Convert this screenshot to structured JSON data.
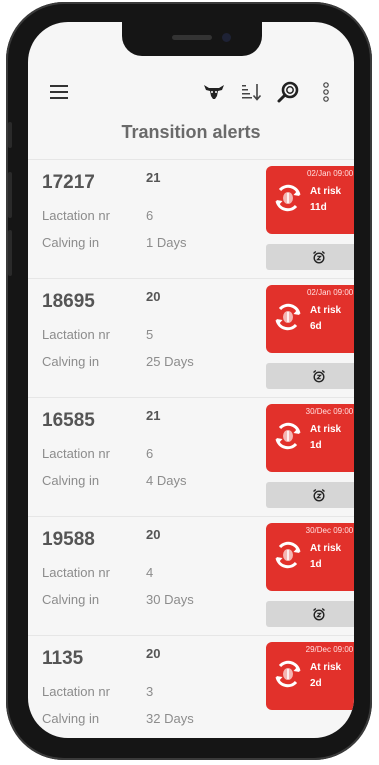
{
  "page": {
    "title": "Transition alerts"
  },
  "toolbar": {
    "icons": [
      "menu-icon",
      "cow-icon",
      "sort-icon",
      "search-icon",
      "more-icon"
    ]
  },
  "fields": {
    "lactation_label": "Lactation nr",
    "calving_label": "Calving in"
  },
  "colors": {
    "alert_red": "#e2312b",
    "alarm_button": "#d6d6d6"
  },
  "cows": [
    {
      "id": "17217",
      "number": "21",
      "lactation": "6",
      "calving": "1 Days",
      "alert_time": "02/Jan 09:00 AM",
      "status": "At risk",
      "days": "11d"
    },
    {
      "id": "18695",
      "number": "20",
      "lactation": "5",
      "calving": "25 Days",
      "alert_time": "02/Jan 09:00 AM",
      "status": "At risk",
      "days": "6d"
    },
    {
      "id": "16585",
      "number": "21",
      "lactation": "6",
      "calving": "4 Days",
      "alert_time": "30/Dec 09:00 AM",
      "status": "At risk",
      "days": "1d"
    },
    {
      "id": "19588",
      "number": "20",
      "lactation": "4",
      "calving": "30 Days",
      "alert_time": "30/Dec 09:00 AM",
      "status": "At risk",
      "days": "1d"
    },
    {
      "id": "1135",
      "number": "20",
      "lactation": "3",
      "calving": "32 Days",
      "alert_time": "29/Dec 09:00 AM",
      "status": "At risk",
      "days": "2d"
    }
  ]
}
